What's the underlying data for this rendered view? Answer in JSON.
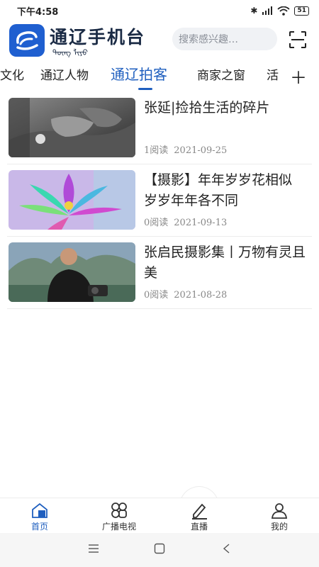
{
  "status_bar": {
    "time": "下午4:58",
    "battery": "51"
  },
  "header": {
    "logo_text": "通辽手机台",
    "logo_sub": "ᠲᠦᠩ ᠯᠢᠶᠣ",
    "search_placeholder": "搜索感兴趣…"
  },
  "tabs": [
    {
      "label": "文化"
    },
    {
      "label": "通辽人物"
    },
    {
      "label": "通辽拍客",
      "active": true
    },
    {
      "label": "商家之窗"
    },
    {
      "label": "活"
    }
  ],
  "articles": [
    {
      "title": "张延|捡拾生活的碎片",
      "reads": "1阅读",
      "date": "2021-09-25",
      "thumb": "bw-hands"
    },
    {
      "title": "【摄影】年年岁岁花相似 岁岁年年各不同",
      "reads": "0阅读",
      "date": "2021-09-13",
      "thumb": "lotus"
    },
    {
      "title": "张启民摄影集丨万物有灵且美",
      "reads": "0阅读",
      "date": "2021-08-28",
      "thumb": "photographer"
    }
  ],
  "bottom_nav": [
    {
      "label": "首页",
      "icon": "home-icon",
      "active": true
    },
    {
      "label": "广播电视",
      "icon": "grid-icon"
    },
    {
      "label": "直播",
      "icon": "pen-icon"
    },
    {
      "label": "我的",
      "icon": "person-icon"
    }
  ],
  "colors": {
    "accent": "#1f5fbf",
    "logo_bg": "#1f5fd0"
  }
}
